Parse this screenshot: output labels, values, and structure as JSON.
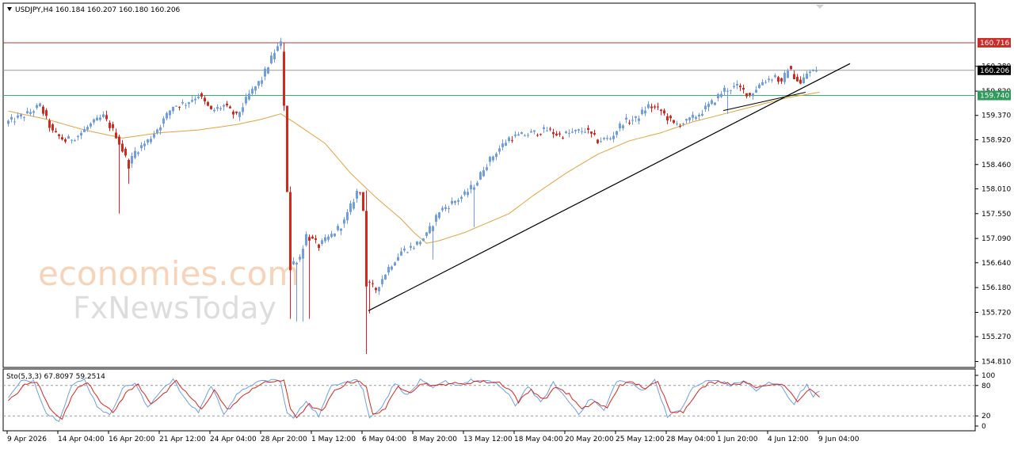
{
  "header": {
    "symbol_label": "USDJPY,H4  160.184 160.207 160.180 160.206"
  },
  "watermark": {
    "line1": "economies.com",
    "line2": "FxNewsToday"
  },
  "colors": {
    "bull": "#6f9fe0",
    "bear": "#d8261c",
    "ma": "#e3a23e",
    "trend": "#000000",
    "resistance_line": "#b0393f",
    "support_line": "#3fae6a",
    "current_line": "#9a9a9a",
    "stoch_main": "#6f9fe0",
    "stoch_signal": "#d8261c"
  },
  "chart_data": [
    {
      "type": "candlestick",
      "symbol": "USDJPY",
      "timeframe": "H4",
      "ylim": [
        154.7,
        161.45
      ],
      "yticks": [
        "160.280",
        "159.820",
        "159.370",
        "158.920",
        "158.460",
        "158.010",
        "157.550",
        "157.090",
        "156.640",
        "156.180",
        "155.720",
        "155.270",
        "154.810"
      ],
      "ytick_values": [
        160.28,
        159.82,
        159.37,
        158.92,
        158.46,
        158.01,
        157.55,
        157.09,
        156.64,
        156.18,
        155.72,
        155.27,
        154.81
      ],
      "xticks": [
        "9 Apr 2026",
        "14 Apr 04:00",
        "16 Apr 20:00",
        "21 Apr 12:00",
        "24 Apr 04:00",
        "28 Apr 20:00",
        "1 May 12:00",
        "6 May 04:00",
        "8 May 20:00",
        "13 May 12:00",
        "18 May 04:00",
        "20 May 20:00",
        "25 May 12:00",
        "28 May 04:00",
        "1 Jun 20:00",
        "4 Jun 12:00",
        "9 Jun 04:00"
      ],
      "xtick_index": [
        0,
        16,
        32,
        48,
        64,
        80,
        96,
        112,
        128,
        144,
        160,
        176,
        192,
        208,
        224,
        240,
        256
      ],
      "num_bars": 260,
      "price_anchors": [
        [
          0,
          159.25
        ],
        [
          6,
          159.4
        ],
        [
          10,
          159.55
        ],
        [
          14,
          159.05
        ],
        [
          18,
          158.9
        ],
        [
          22,
          159.0
        ],
        [
          26,
          159.2
        ],
        [
          30,
          159.35
        ],
        [
          34,
          159.0
        ],
        [
          38,
          158.45
        ],
        [
          40,
          158.7
        ],
        [
          44,
          158.9
        ],
        [
          48,
          159.2
        ],
        [
          52,
          159.55
        ],
        [
          56,
          159.6
        ],
        [
          60,
          159.75
        ],
        [
          64,
          159.45
        ],
        [
          68,
          159.55
        ],
        [
          72,
          159.35
        ],
        [
          76,
          159.75
        ],
        [
          80,
          160.05
        ],
        [
          84,
          160.55
        ],
        [
          86,
          160.7
        ],
        [
          87,
          159.5
        ],
        [
          89,
          156.6
        ],
        [
          92,
          156.75
        ],
        [
          94,
          157.15
        ],
        [
          98,
          156.95
        ],
        [
          102,
          157.15
        ],
        [
          106,
          157.4
        ],
        [
          110,
          157.95
        ],
        [
          112,
          157.95
        ],
        [
          113,
          156.25
        ],
        [
          116,
          156.15
        ],
        [
          120,
          156.55
        ],
        [
          124,
          156.85
        ],
        [
          128,
          156.95
        ],
        [
          132,
          157.15
        ],
        [
          136,
          157.6
        ],
        [
          140,
          157.75
        ],
        [
          144,
          157.9
        ],
        [
          148,
          158.15
        ],
        [
          150,
          158.4
        ],
        [
          154,
          158.7
        ],
        [
          158,
          158.95
        ],
        [
          162,
          159.0
        ],
        [
          166,
          159.05
        ],
        [
          170,
          159.1
        ],
        [
          174,
          159.0
        ],
        [
          178,
          159.05
        ],
        [
          182,
          159.1
        ],
        [
          186,
          158.9
        ],
        [
          190,
          158.95
        ],
        [
          194,
          159.25
        ],
        [
          198,
          159.3
        ],
        [
          202,
          159.55
        ],
        [
          206,
          159.45
        ],
        [
          210,
          159.2
        ],
        [
          214,
          159.25
        ],
        [
          218,
          159.4
        ],
        [
          222,
          159.6
        ],
        [
          226,
          159.85
        ],
        [
          230,
          159.9
        ],
        [
          234,
          159.75
        ],
        [
          238,
          160.0
        ],
        [
          242,
          160.1
        ],
        [
          244,
          159.95
        ],
        [
          246,
          160.25
        ],
        [
          248,
          160.1
        ],
        [
          250,
          159.95
        ],
        [
          252,
          160.15
        ],
        [
          255,
          160.206
        ]
      ],
      "spikes": [
        {
          "bar": 35,
          "low": 157.55
        },
        {
          "bar": 38,
          "low": 158.1
        },
        {
          "bar": 87,
          "high": 160.716
        },
        {
          "bar": 89,
          "low": 155.6
        },
        {
          "bar": 91,
          "low": 155.55
        },
        {
          "bar": 93,
          "low": 155.55
        },
        {
          "bar": 95,
          "low": 155.6
        },
        {
          "bar": 113,
          "low": 154.95
        },
        {
          "bar": 114,
          "low": 155.7
        },
        {
          "bar": 134,
          "low": 156.7
        },
        {
          "bar": 147,
          "low": 157.3
        },
        {
          "bar": 227,
          "low": 159.4
        }
      ],
      "moving_average_anchors": [
        [
          0,
          159.45
        ],
        [
          12,
          159.3
        ],
        [
          24,
          159.1
        ],
        [
          36,
          158.95
        ],
        [
          48,
          159.05
        ],
        [
          60,
          159.1
        ],
        [
          72,
          159.2
        ],
        [
          80,
          159.3
        ],
        [
          86,
          159.4
        ],
        [
          90,
          159.25
        ],
        [
          100,
          158.85
        ],
        [
          108,
          158.3
        ],
        [
          116,
          157.85
        ],
        [
          124,
          157.45
        ],
        [
          128,
          157.2
        ],
        [
          132,
          157.0
        ],
        [
          136,
          157.05
        ],
        [
          144,
          157.2
        ],
        [
          152,
          157.4
        ],
        [
          158,
          157.55
        ],
        [
          166,
          157.9
        ],
        [
          176,
          158.3
        ],
        [
          186,
          158.65
        ],
        [
          196,
          158.9
        ],
        [
          206,
          159.05
        ],
        [
          216,
          159.25
        ],
        [
          226,
          159.4
        ],
        [
          236,
          159.55
        ],
        [
          246,
          159.7
        ],
        [
          256,
          159.8
        ]
      ],
      "horizontal_levels": [
        {
          "label": "160.716",
          "value": 160.716,
          "role": "resistance"
        },
        {
          "label": "160.206",
          "value": 160.206,
          "role": "current"
        },
        {
          "label": "159.740",
          "value": 159.74,
          "role": "support"
        }
      ],
      "trendline": {
        "from": [
          114,
          155.75
        ],
        "to": [
          266,
          160.33
        ]
      },
      "trendline_ext": {
        "from": [
          226,
          159.46
        ],
        "to": [
          252,
          159.8
        ]
      },
      "last": {
        "open": 160.184,
        "high": 160.207,
        "low": 160.18,
        "close": 160.206
      }
    },
    {
      "type": "line",
      "indicator": "Stochastic",
      "label": "Sto(5,3,3) 67.8097 59.2514",
      "main_value": 67.8097,
      "signal_value": 59.2514,
      "ylim": [
        0,
        100
      ],
      "levels": [
        80,
        20
      ],
      "yticks": [
        "100",
        "80",
        "20",
        "0"
      ],
      "ytick_values": [
        100,
        80,
        20,
        0
      ],
      "series": [
        {
          "role": "main",
          "anchors": [
            [
              0,
              55
            ],
            [
              4,
              88
            ],
            [
              8,
              90
            ],
            [
              12,
              25
            ],
            [
              16,
              12
            ],
            [
              20,
              80
            ],
            [
              24,
              92
            ],
            [
              28,
              40
            ],
            [
              32,
              20
            ],
            [
              36,
              75
            ],
            [
              40,
              85
            ],
            [
              44,
              35
            ],
            [
              48,
              70
            ],
            [
              52,
              92
            ],
            [
              56,
              50
            ],
            [
              60,
              28
            ],
            [
              64,
              80
            ],
            [
              68,
              25
            ],
            [
              72,
              60
            ],
            [
              76,
              80
            ],
            [
              80,
              88
            ],
            [
              84,
              92
            ],
            [
              86,
              85
            ],
            [
              88,
              25
            ],
            [
              90,
              15
            ],
            [
              94,
              50
            ],
            [
              98,
              20
            ],
            [
              102,
              80
            ],
            [
              106,
              88
            ],
            [
              110,
              92
            ],
            [
              112,
              70
            ],
            [
              114,
              15
            ],
            [
              118,
              40
            ],
            [
              122,
              85
            ],
            [
              126,
              60
            ],
            [
              130,
              90
            ],
            [
              134,
              75
            ],
            [
              138,
              88
            ],
            [
              142,
              80
            ],
            [
              146,
              90
            ],
            [
              150,
              88
            ],
            [
              154,
              85
            ],
            [
              158,
              60
            ],
            [
              160,
              40
            ],
            [
              164,
              80
            ],
            [
              168,
              45
            ],
            [
              172,
              85
            ],
            [
              176,
              55
            ],
            [
              180,
              25
            ],
            [
              184,
              55
            ],
            [
              188,
              30
            ],
            [
              192,
              90
            ],
            [
              196,
              85
            ],
            [
              200,
              70
            ],
            [
              204,
              90
            ],
            [
              208,
              20
            ],
            [
              212,
              30
            ],
            [
              216,
              75
            ],
            [
              220,
              88
            ],
            [
              224,
              90
            ],
            [
              228,
              80
            ],
            [
              232,
              90
            ],
            [
              236,
              70
            ],
            [
              240,
              85
            ],
            [
              244,
              80
            ],
            [
              248,
              40
            ],
            [
              250,
              70
            ],
            [
              252,
              80
            ],
            [
              254,
              60
            ],
            [
              256,
              67.8
            ]
          ]
        },
        {
          "role": "signal",
          "anchors": [
            [
              0,
              48
            ],
            [
              5,
              80
            ],
            [
              9,
              88
            ],
            [
              13,
              35
            ],
            [
              17,
              15
            ],
            [
              21,
              70
            ],
            [
              25,
              88
            ],
            [
              29,
              50
            ],
            [
              33,
              25
            ],
            [
              37,
              65
            ],
            [
              41,
              82
            ],
            [
              45,
              45
            ],
            [
              49,
              62
            ],
            [
              53,
              88
            ],
            [
              57,
              60
            ],
            [
              61,
              32
            ],
            [
              65,
              72
            ],
            [
              69,
              32
            ],
            [
              73,
              52
            ],
            [
              77,
              75
            ],
            [
              81,
              85
            ],
            [
              85,
              90
            ],
            [
              87,
              88
            ],
            [
              89,
              35
            ],
            [
              91,
              18
            ],
            [
              95,
              42
            ],
            [
              99,
              28
            ],
            [
              103,
              70
            ],
            [
              107,
              85
            ],
            [
              111,
              90
            ],
            [
              113,
              75
            ],
            [
              115,
              22
            ],
            [
              119,
              35
            ],
            [
              123,
              78
            ],
            [
              127,
              68
            ],
            [
              131,
              85
            ],
            [
              135,
              78
            ],
            [
              139,
              85
            ],
            [
              143,
              82
            ],
            [
              147,
              88
            ],
            [
              151,
              87
            ],
            [
              155,
              86
            ],
            [
              159,
              68
            ],
            [
              161,
              48
            ],
            [
              165,
              72
            ],
            [
              169,
              52
            ],
            [
              173,
              78
            ],
            [
              177,
              62
            ],
            [
              181,
              32
            ],
            [
              185,
              48
            ],
            [
              189,
              35
            ],
            [
              193,
              82
            ],
            [
              197,
              86
            ],
            [
              201,
              75
            ],
            [
              205,
              86
            ],
            [
              209,
              30
            ],
            [
              213,
              28
            ],
            [
              217,
              65
            ],
            [
              221,
              84
            ],
            [
              225,
              88
            ],
            [
              229,
              82
            ],
            [
              233,
              87
            ],
            [
              237,
              75
            ],
            [
              241,
              82
            ],
            [
              245,
              82
            ],
            [
              249,
              50
            ],
            [
              251,
              62
            ],
            [
              253,
              75
            ],
            [
              255,
              62
            ],
            [
              256,
              59.25
            ]
          ]
        }
      ]
    }
  ]
}
